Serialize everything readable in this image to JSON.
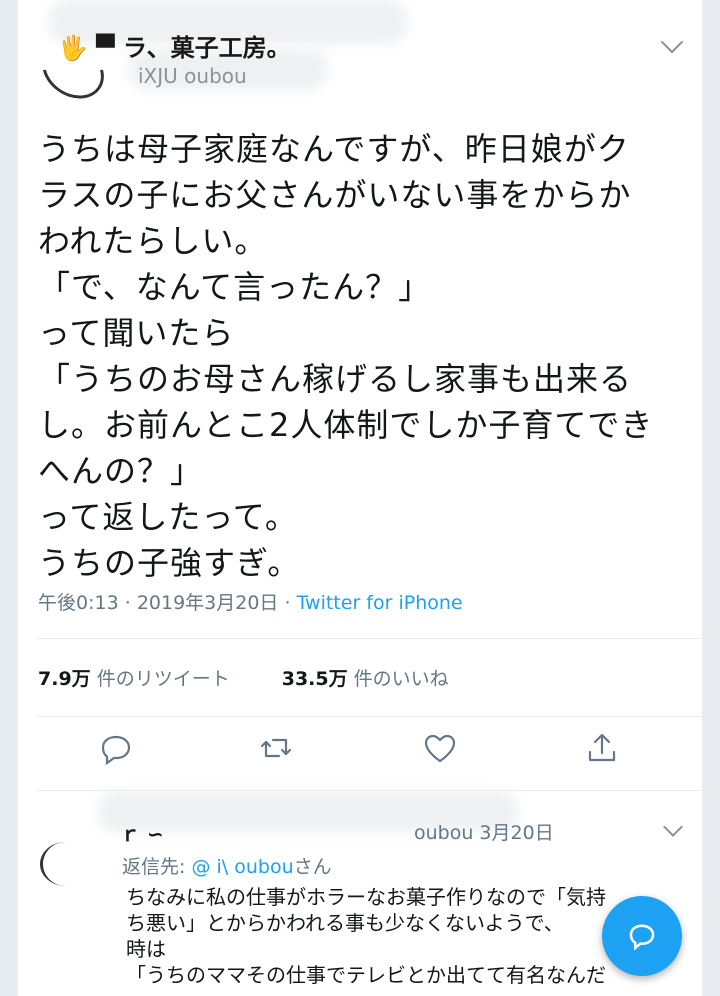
{
  "tweet": {
    "author_name_visible": "🖐 ▀  ラ、菓子工房。",
    "handle_visible": "iXJU  oubou",
    "lines": [
      "うちは母子家庭なんですが、昨日娘がク",
      "ラスの子にお父さんがいない事をからか",
      "われたらしい。",
      "「で、なんて言ったん？」",
      "って聞いたら",
      "「うちのお母さん稼げるし家事も出来る",
      "し。お前んとこ2人体制でしか子育てでき",
      "へんの？」",
      "って返したって。",
      "うちの子強すぎ。"
    ],
    "time": "午後0:13",
    "date": "2019年3月20日",
    "separator": "·",
    "source": "Twitter for iPhone",
    "retweets_count": "7.9万",
    "retweets_label": "件のリツイート",
    "likes_count": "33.5万",
    "likes_label": "件のいいね"
  },
  "actions": {
    "reply": "reply-icon",
    "retweet": "retweet-icon",
    "like": "heart-icon",
    "share": "share-icon"
  },
  "reply": {
    "name_visible": "ｒ  ∽",
    "handle_date": "oubou   3月20日",
    "reply_to_prefix": "返信先: ",
    "reply_to_handle": "@ i\\    oubou",
    "reply_to_suffix": "さん",
    "lines": [
      "ちなみに私の仕事がホラーなお菓子作りなので「気持",
      "ち悪い」とからかわれる事も少なくないようで、",
      "時は",
      "「うちのママその仕事でテレビとか出てて有名なんだ"
    ]
  },
  "colors": {
    "accent": "#1da1f2",
    "text": "#14171a",
    "muted": "#657786"
  }
}
